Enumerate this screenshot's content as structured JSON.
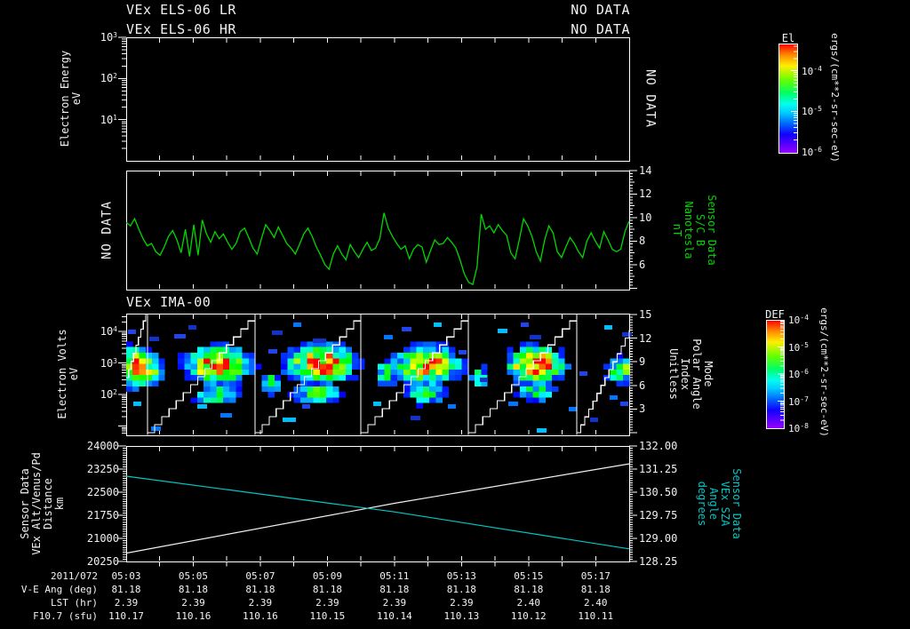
{
  "titles": {
    "els_lr": "VEx ELS-06 LR",
    "els_hr": "VEx ELS-06 HR",
    "nodata_lr": "NO DATA",
    "nodata_hr": "NO DATA",
    "ima": "VEx IMA-00"
  },
  "labels": {
    "p1_left": "Electron Energy\neV",
    "p1_right": "NO DATA",
    "p2_left": "NO DATA",
    "p2_right": "Sensor Data\nS/C B\nNanotesla\nnT",
    "p3_left": "Electron Volts\neV",
    "p3_right": "Mode\nPolar Angle\nIndex\nUnitless",
    "p4_left": "Sensor Data\nVEx Alt/Venus/Pd\nDistance\nkm",
    "p4_right": "Sensor Data\nVEx SZA\nAngle\ndegrees"
  },
  "colorbars": [
    {
      "title": "El",
      "units": "ergs/(cm**2-sr-sec-eV)",
      "tick_exponents": [
        -4,
        -5,
        -6
      ]
    },
    {
      "title": "DEF",
      "units": "ergs/(cm**2-sr-sec-eV)",
      "tick_exponents": [
        -4,
        -5,
        -6,
        -7,
        -8
      ]
    }
  ],
  "bottom": {
    "date": "2011/072",
    "row_labels": [
      "V-E Ang (deg)",
      "LST (hr)",
      "F10.7 (sfu)"
    ],
    "columns": [
      {
        "time": "05:03",
        "values": [
          "81.18",
          "2.39",
          "110.17"
        ]
      },
      {
        "time": "05:05",
        "values": [
          "81.18",
          "2.39",
          "110.16"
        ]
      },
      {
        "time": "05:07",
        "values": [
          "81.18",
          "2.39",
          "110.16"
        ]
      },
      {
        "time": "05:09",
        "values": [
          "81.18",
          "2.39",
          "110.15"
        ]
      },
      {
        "time": "05:11",
        "values": [
          "81.18",
          "2.39",
          "110.14"
        ]
      },
      {
        "time": "05:13",
        "values": [
          "81.18",
          "2.39",
          "110.13"
        ]
      },
      {
        "time": "05:15",
        "values": [
          "81.18",
          "2.40",
          "110.12"
        ]
      },
      {
        "time": "05:17",
        "values": [
          "81.18",
          "2.40",
          "110.11"
        ]
      }
    ]
  },
  "chart_data": [
    {
      "type": "spectrogram",
      "title": "VEx ELS-06 LR / VEx ELS-06 HR",
      "status": "NO DATA",
      "ylabel": "Electron Energy (eV)",
      "yscale": "log",
      "ytick_exponents": [
        3,
        2,
        1
      ],
      "x_range": [
        "05:03",
        "05:18"
      ],
      "colorbar": "El",
      "data": null
    },
    {
      "type": "line",
      "name": "S/C B",
      "units": "nT",
      "color": "#00d800",
      "x_start": "05:03",
      "x_span_minutes": 15,
      "y_ticks": [
        14,
        12,
        10,
        8,
        6
      ],
      "y_range": [
        3.87,
        14
      ],
      "values": [
        9.6,
        9.3,
        9.9,
        9.0,
        8.2,
        7.6,
        7.8,
        7.1,
        6.8,
        7.5,
        8.4,
        8.9,
        8.1,
        7.0,
        9.0,
        6.7,
        9.4,
        6.8,
        9.8,
        8.6,
        7.9,
        8.8,
        8.2,
        8.6,
        7.9,
        7.3,
        7.8,
        8.8,
        9.1,
        8.3,
        7.4,
        6.9,
        8.2,
        9.4,
        8.9,
        8.3,
        9.2,
        8.5,
        7.8,
        7.4,
        6.9,
        7.7,
        8.6,
        9.1,
        8.4,
        7.5,
        6.8,
        6.0,
        5.6,
        6.9,
        7.6,
        6.9,
        6.4,
        7.7,
        7.1,
        6.6,
        7.3,
        7.9,
        7.2,
        7.4,
        8.2,
        10.4,
        9.1,
        8.4,
        7.8,
        7.3,
        7.6,
        6.5,
        7.3,
        7.7,
        7.5,
        6.2,
        7.2,
        8.1,
        7.7,
        7.8,
        8.3,
        7.9,
        7.4,
        6.4,
        5.2,
        4.5,
        4.3,
        5.8,
        10.3,
        9.0,
        9.3,
        8.7,
        9.4,
        8.9,
        8.5,
        7.0,
        6.5,
        8.1,
        9.9,
        9.3,
        8.4,
        7.1,
        6.3,
        8.1,
        9.3,
        8.7,
        7.1,
        6.6,
        7.5,
        8.3,
        7.8,
        7.1,
        6.6,
        8.0,
        8.7,
        8.0,
        7.4,
        8.8,
        8.1,
        7.3,
        7.1,
        7.3,
        8.8,
        9.7
      ]
    },
    {
      "type": "spectrogram",
      "title": "VEx IMA-00",
      "ylabel": "Electron Volts (eV)",
      "yscale": "log",
      "ytick_exponents": [
        4,
        3,
        2
      ],
      "right_axis": {
        "label": "Mode Polar Angle Index (Unitless)",
        "ticks": [
          15,
          12,
          9,
          6,
          3
        ]
      },
      "colorbar": "DEF",
      "blobs": [
        [
          152,
          414,
          15,
          13,
          1.0
        ],
        [
          174,
          420,
          7,
          8,
          0.5
        ],
        [
          245,
          411,
          21,
          12,
          1.05
        ],
        [
          244,
          444,
          16,
          8,
          0.5
        ],
        [
          305,
          430,
          8,
          9,
          0.45
        ],
        [
          362,
          409,
          23,
          12,
          1.05
        ],
        [
          358,
          442,
          18,
          8,
          0.5
        ],
        [
          435,
          420,
          8,
          9,
          0.5
        ],
        [
          481,
          411,
          21,
          12,
          1.05
        ],
        [
          479,
          443,
          15,
          8,
          0.45
        ],
        [
          540,
          424,
          7,
          8,
          0.42
        ],
        [
          603,
          411,
          19,
          12,
          1.05
        ],
        [
          604,
          440,
          14,
          8,
          0.45
        ],
        [
          700,
          417,
          11,
          9,
          0.6
        ]
      ],
      "stripes": [
        [
          144,
          371,
          9
        ],
        [
          168,
          379,
          11
        ],
        [
          150,
          452,
          9
        ],
        [
          170,
          480,
          11
        ],
        [
          196,
          376,
          13
        ],
        [
          212,
          366,
          9
        ],
        [
          222,
          455,
          11
        ],
        [
          248,
          465,
          13
        ],
        [
          302,
          393,
          10
        ],
        [
          306,
          372,
          12
        ],
        [
          318,
          470,
          15
        ],
        [
          330,
          363,
          9
        ],
        [
          340,
          455,
          9
        ],
        [
          352,
          381,
          15
        ],
        [
          420,
          452,
          9
        ],
        [
          432,
          377,
          10
        ],
        [
          452,
          368,
          11
        ],
        [
          462,
          468,
          11
        ],
        [
          488,
          363,
          9
        ],
        [
          504,
          455,
          9
        ],
        [
          516,
          394,
          9
        ],
        [
          540,
          425,
          9
        ],
        [
          560,
          370,
          11
        ],
        [
          572,
          452,
          11
        ],
        [
          586,
          363,
          9
        ],
        [
          596,
          377,
          13
        ],
        [
          604,
          482,
          11
        ],
        [
          640,
          458,
          9
        ],
        [
          652,
          418,
          9
        ],
        [
          664,
          470,
          9
        ],
        [
          680,
          366,
          9
        ],
        [
          686,
          445,
          9
        ],
        [
          698,
          452,
          9
        ],
        [
          700,
          374,
          11
        ]
      ],
      "cycles": [
        [
          142,
          164,
          7.0,
          15.2
        ],
        [
          166,
          287,
          0,
          15.2
        ],
        [
          287,
          406,
          0,
          15.2
        ],
        [
          406,
          527,
          0,
          15.2
        ],
        [
          527,
          649,
          0,
          15.2
        ],
        [
          649,
          708,
          0,
          13.0
        ]
      ],
      "vlines": [
        166,
        287,
        406,
        527,
        649
      ]
    },
    {
      "type": "line",
      "series": [
        {
          "name": "VEx Alt/Venus/Pd Distance",
          "units": "km",
          "axis": "left",
          "color": "#f0f0f0",
          "points": [
            [
              0,
              20520
            ],
            [
              8,
              22140
            ],
            [
              15,
              23420
            ]
          ]
        },
        {
          "name": "VEx SZA Angle",
          "units": "degrees",
          "axis": "right",
          "color": "#00c8c8",
          "points": [
            [
              0,
              131.02
            ],
            [
              8,
              129.86
            ],
            [
              15,
              128.66
            ]
          ]
        }
      ],
      "left_ticks": [
        24000,
        23250,
        22500,
        21750,
        21000,
        20250
      ],
      "left_range": [
        20250,
        24000
      ],
      "right_ticks": [
        "132.00",
        "131.25",
        "130.50",
        "129.75",
        "129.00",
        "128.25"
      ],
      "right_range": [
        128.25,
        132.0
      ]
    }
  ]
}
